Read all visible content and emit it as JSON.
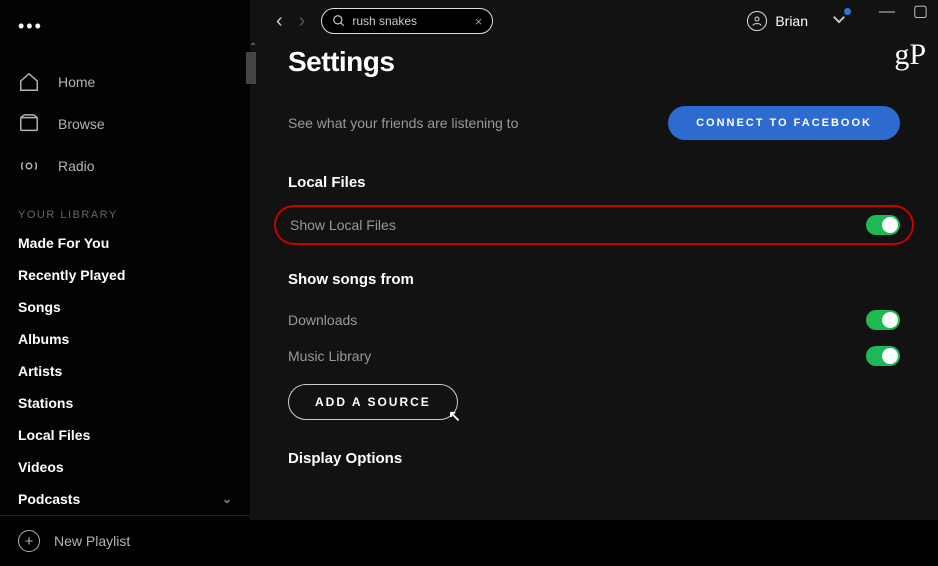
{
  "window": {
    "minimize": "—",
    "maximize": "▢"
  },
  "watermark": "gP",
  "sidebar": {
    "nav": [
      {
        "label": "Home",
        "icon": "home"
      },
      {
        "label": "Browse",
        "icon": "browse"
      },
      {
        "label": "Radio",
        "icon": "radio"
      }
    ],
    "library_header": "YOUR LIBRARY",
    "library": [
      "Made For You",
      "Recently Played",
      "Songs",
      "Albums",
      "Artists",
      "Stations",
      "Local Files",
      "Videos",
      "Podcasts"
    ],
    "new_playlist": "New Playlist"
  },
  "topbar": {
    "search_value": "rush snakes",
    "username": "Brian"
  },
  "settings": {
    "title": "Settings",
    "friends_desc": "See what your friends are listening to",
    "facebook_btn": "CONNECT TO FACEBOOK",
    "local_files_header": "Local Files",
    "show_local_files": "Show Local Files",
    "show_songs_from": "Show songs from",
    "sources": [
      {
        "label": "Downloads",
        "enabled": true
      },
      {
        "label": "Music Library",
        "enabled": true
      }
    ],
    "add_source": "ADD A SOURCE",
    "display_options": "Display Options"
  }
}
